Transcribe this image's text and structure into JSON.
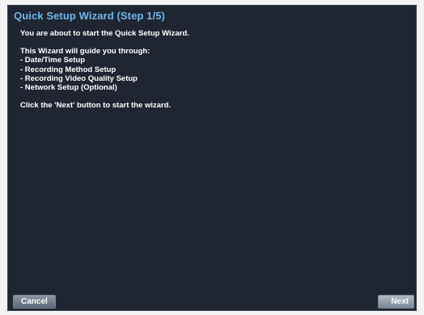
{
  "wizard": {
    "title": "Quick Setup Wizard (Step 1/5)",
    "intro": "You are about to start the Quick Setup Wizard.",
    "guide_heading": "This Wizard will guide you through:",
    "steps": [
      "- Date/Time Setup",
      "- Recording Method Setup",
      "- Recording Video Quality Setup",
      "- Network Setup (Optional)"
    ],
    "instruction": "Click the 'Next' button to start the wizard."
  },
  "buttons": {
    "cancel_label": "Cancel",
    "next_label": "Next"
  },
  "colors": {
    "background": "#1f2631",
    "title": "#6eb7ea",
    "text": "#ffffff"
  }
}
